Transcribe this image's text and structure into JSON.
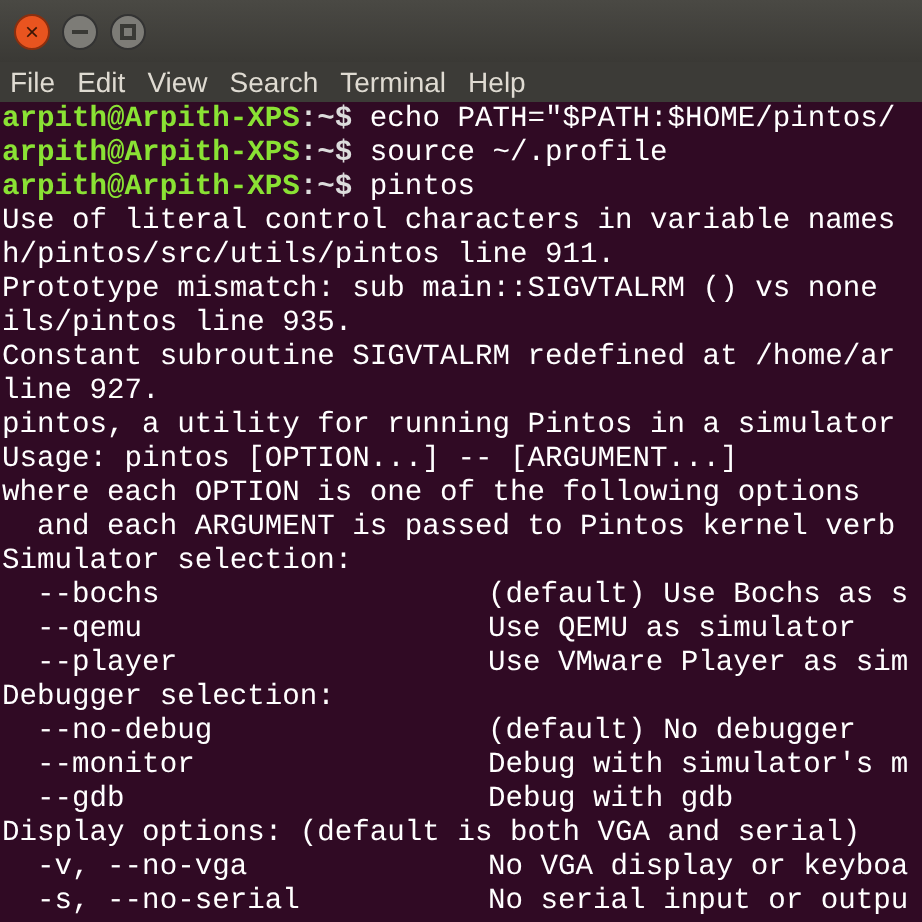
{
  "window": {
    "controls": [
      {
        "kind": "close",
        "symbol": "×"
      },
      {
        "kind": "minimize"
      },
      {
        "kind": "maximize"
      }
    ]
  },
  "menu": [
    "File",
    "Edit",
    "View",
    "Search",
    "Terminal",
    "Help"
  ],
  "lines": [
    {
      "kind": "prompt",
      "user": "arpith@Arpith-XPS",
      "path": ":~$",
      "command": "echo PATH=\"$PATH:$HOME/pintos/"
    },
    {
      "kind": "prompt",
      "user": "arpith@Arpith-XPS",
      "path": ":~$",
      "command": "source ~/.profile"
    },
    {
      "kind": "prompt",
      "user": "arpith@Arpith-XPS",
      "path": ":~$",
      "command": "pintos"
    },
    {
      "kind": "output",
      "text": "Use of literal control characters in variable names"
    },
    {
      "kind": "output",
      "text": "h/pintos/src/utils/pintos line 911."
    },
    {
      "kind": "output",
      "text": "Prototype mismatch: sub main::SIGVTALRM () vs none"
    },
    {
      "kind": "output",
      "text": "ils/pintos line 935."
    },
    {
      "kind": "output",
      "text": "Constant subroutine SIGVTALRM redefined at /home/ar"
    },
    {
      "kind": "output",
      "text": "line 927."
    },
    {
      "kind": "output",
      "text": "pintos, a utility for running Pintos in a simulator"
    },
    {
      "kind": "output",
      "text": "Usage: pintos [OPTION...] -- [ARGUMENT...]"
    },
    {
      "kind": "output",
      "text": "where each OPTION is one of the following options"
    },
    {
      "kind": "output",
      "text": "  and each ARGUMENT is passed to Pintos kernel verb"
    },
    {
      "kind": "output",
      "text": "Simulator selection:"
    },
    {
      "kind": "option",
      "flag": "  --bochs",
      "description": "(default) Use Bochs as s"
    },
    {
      "kind": "option",
      "flag": "  --qemu",
      "description": "Use QEMU as simulator"
    },
    {
      "kind": "option",
      "flag": "  --player",
      "description": "Use VMware Player as sim"
    },
    {
      "kind": "output",
      "text": "Debugger selection:"
    },
    {
      "kind": "option",
      "flag": "  --no-debug",
      "description": "(default) No debugger"
    },
    {
      "kind": "option",
      "flag": "  --monitor",
      "description": "Debug with simulator's m"
    },
    {
      "kind": "option",
      "flag": "  --gdb",
      "description": "Debug with gdb"
    },
    {
      "kind": "output",
      "text": "Display options: (default is both VGA and serial)"
    },
    {
      "kind": "option",
      "flag": "  -v, --no-vga",
      "description": "No VGA display or keyboa"
    },
    {
      "kind": "option",
      "flag": "  -s, --no-serial",
      "description": "No serial input or outpu"
    }
  ]
}
